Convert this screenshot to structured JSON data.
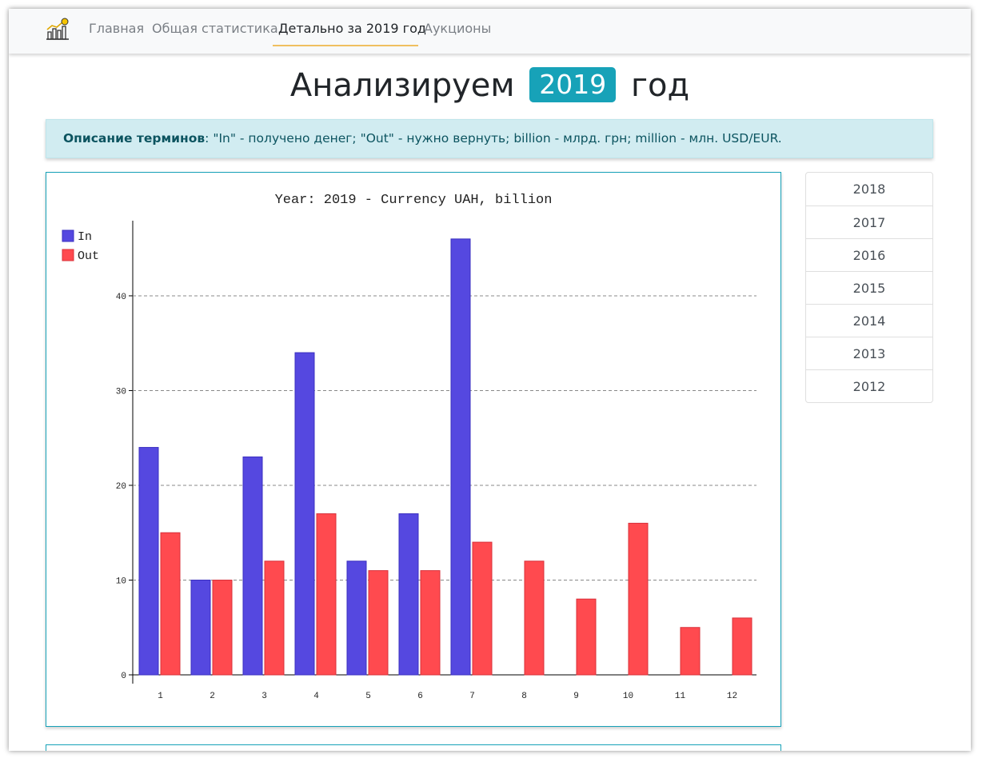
{
  "nav": {
    "items": [
      {
        "label": "Главная",
        "active": false
      },
      {
        "label": "Общая статистика",
        "active": false
      },
      {
        "label": "Детально за 2019 год",
        "active": true
      },
      {
        "label": "Аукционы",
        "active": false
      }
    ],
    "brand_icon": "chart-growth-coin-icon"
  },
  "heading": {
    "prefix": "Анализируем",
    "year": "2019",
    "suffix": "год"
  },
  "alert": {
    "label": "Описание терминов",
    "text": ": \"In\" - получено денег; \"Out\" - нужно вернуть; billion - млрд. грн; million - млн. USD/EUR."
  },
  "years": [
    "2018",
    "2017",
    "2016",
    "2015",
    "2014",
    "2013",
    "2012"
  ],
  "colors": {
    "in": "#5548e0",
    "out": "#ff4a4f",
    "accent": "#17a2b8"
  },
  "chart_data": {
    "type": "bar",
    "title": "Year: 2019 - Currency UAH, billion",
    "categories": [
      "1",
      "2",
      "3",
      "4",
      "5",
      "6",
      "7",
      "8",
      "9",
      "10",
      "11",
      "12"
    ],
    "series": [
      {
        "name": "In",
        "values": [
          24,
          10,
          23,
          34,
          12,
          17,
          46,
          0,
          0,
          0,
          0,
          0
        ]
      },
      {
        "name": "Out",
        "values": [
          15,
          10,
          12,
          17,
          11,
          11,
          14,
          12,
          8,
          16,
          5,
          6
        ]
      }
    ],
    "yticks": [
      0,
      10,
      20,
      30,
      40
    ],
    "ylim": [
      0,
      47
    ],
    "grid": true,
    "legend": "top-left"
  }
}
